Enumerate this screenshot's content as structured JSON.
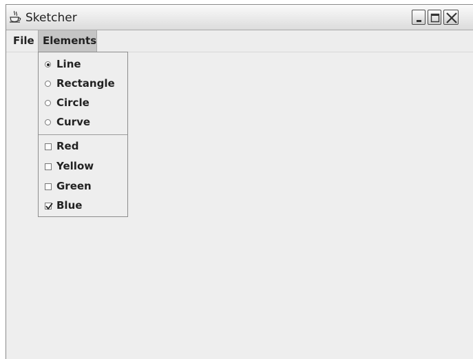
{
  "window": {
    "title": "Sketcher",
    "icon": "java-cup-icon"
  },
  "titlebar_buttons": [
    "minimize-icon",
    "maximize-icon",
    "close-icon"
  ],
  "menubar": {
    "items": [
      "File",
      "Elements"
    ],
    "active": "Elements"
  },
  "elements_menu": {
    "shapes": [
      {
        "label": "Line",
        "selected": true
      },
      {
        "label": "Rectangle",
        "selected": false
      },
      {
        "label": "Circle",
        "selected": false
      },
      {
        "label": "Curve",
        "selected": false
      }
    ],
    "colors": [
      {
        "label": "Red",
        "checked": false
      },
      {
        "label": "Yellow",
        "checked": false
      },
      {
        "label": "Green",
        "checked": false
      },
      {
        "label": "Blue",
        "checked": true
      }
    ]
  }
}
